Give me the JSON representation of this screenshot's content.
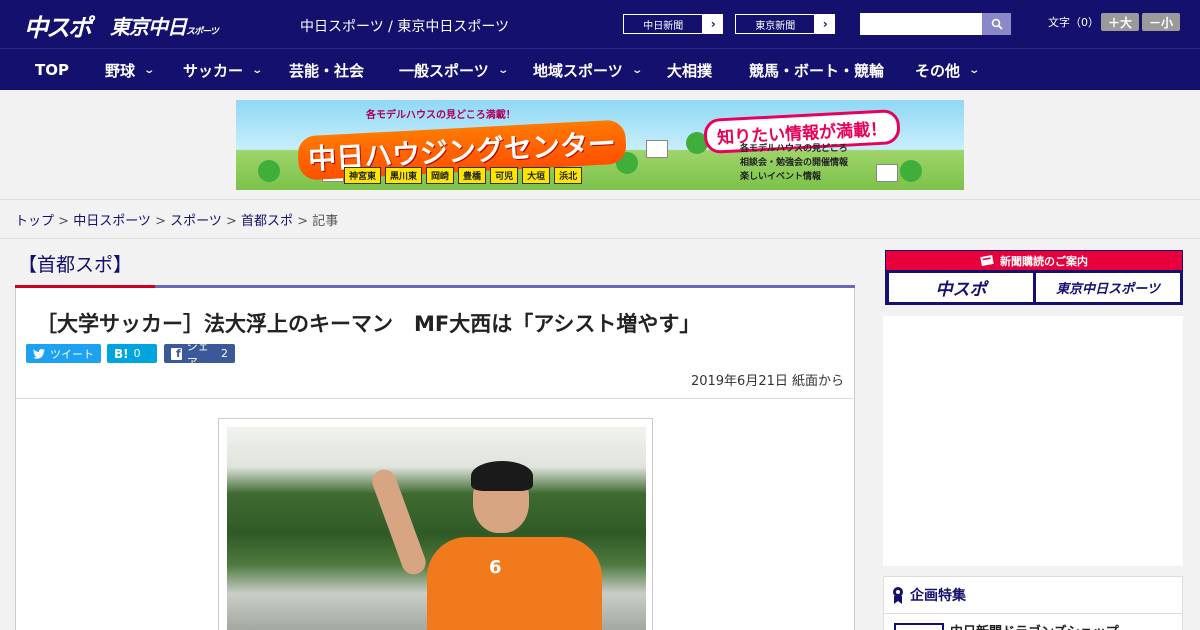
{
  "header": {
    "logo_chunichi_sports": "中スポ",
    "logo_tokyo": "東京中日",
    "logo_tokyo_small": "スポーツ",
    "site_link": "中日スポーツ / 東京中日スポーツ",
    "paper_buttons": [
      "中日新聞",
      "東京新聞"
    ],
    "search_placeholder": "",
    "font_size_label": "文字（0）",
    "font_up": "＋大",
    "font_down": "－小"
  },
  "nav": {
    "items": [
      {
        "label": "TOP",
        "has_menu": false
      },
      {
        "label": "野球",
        "has_menu": true
      },
      {
        "label": "サッカー",
        "has_menu": true
      },
      {
        "label": "芸能・社会",
        "has_menu": false
      },
      {
        "label": "一般スポーツ",
        "has_menu": true
      },
      {
        "label": "地域スポーツ",
        "has_menu": true
      },
      {
        "label": "大相撲",
        "has_menu": false
      },
      {
        "label": "競馬・ボート・競輪",
        "has_menu": false
      },
      {
        "label": "その他",
        "has_menu": true
      }
    ]
  },
  "banner": {
    "tagline": "各モデルハウスの見どころ満載！",
    "title": "中日ハウジングセンター",
    "bubble": "知りたい情報が満載！",
    "towns": [
      "神宮東",
      "黒川東",
      "岡崎",
      "豊橋",
      "可児",
      "大垣",
      "浜北"
    ],
    "list": [
      "各モデルハウスの見どころ",
      "相談会・勉強会の開催情報",
      "楽しいイベント情報"
    ]
  },
  "breadcrumb": {
    "links": [
      "トップ",
      "中日スポーツ",
      "スポーツ",
      "首都スポ"
    ],
    "current": "記事",
    "separator": " > "
  },
  "section": {
    "title": "【首都スポ】"
  },
  "article": {
    "headline": "［大学サッカー］法大浮上のキーマン　MF大西は「アシスト増やす」",
    "share": {
      "tweet_label": "ツイート",
      "hatena_count": "0",
      "facebook_label": "シェア",
      "facebook_count": "2"
    },
    "dateline": "2019年6月21日 紙面から",
    "jersey_number": "6"
  },
  "sidebar": {
    "subscribe_title": "新聞購読のご案内",
    "subscribe_buttons": [
      "中スポ",
      "東京中日スポーツ"
    ],
    "feature_title": "企画特集",
    "feature_item": "中日新聞ドラゴンズショップ"
  },
  "colors": {
    "brand_navy": "#14106e",
    "accent_red": "#d00020",
    "twitter": "#1da1f2",
    "hatena": "#00a4de",
    "facebook": "#3b5998"
  }
}
